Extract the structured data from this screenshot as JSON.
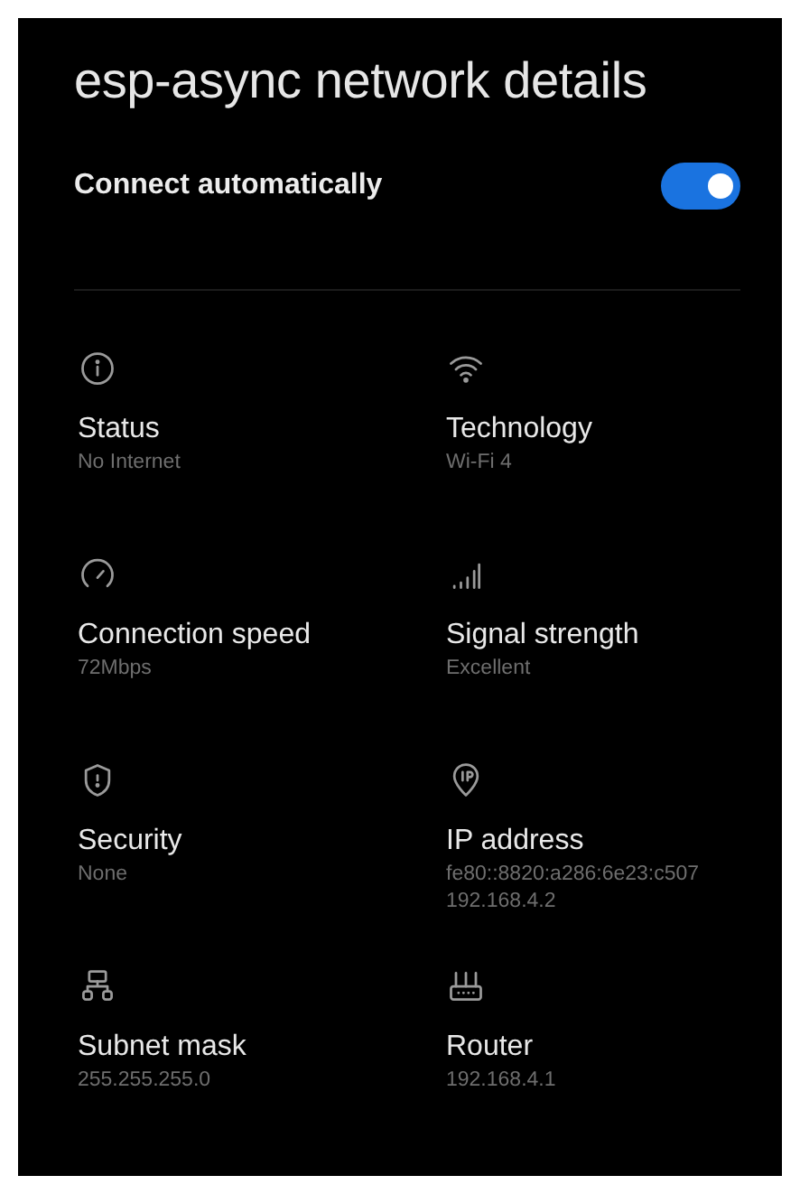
{
  "title": "esp-async network details",
  "auto_connect": {
    "label": "Connect automatically",
    "on": true
  },
  "details": [
    {
      "kind": "info",
      "label": "Status",
      "values": [
        "No Internet"
      ]
    },
    {
      "kind": "wifi",
      "label": "Technology",
      "values": [
        "Wi-Fi 4"
      ]
    },
    {
      "kind": "speed",
      "label": "Connection speed",
      "values": [
        "72Mbps"
      ]
    },
    {
      "kind": "signal",
      "label": "Signal strength",
      "values": [
        "Excellent"
      ]
    },
    {
      "kind": "shield",
      "label": "Security",
      "values": [
        "None"
      ]
    },
    {
      "kind": "pin",
      "label": "IP address",
      "values": [
        "fe80::8820:a286:6e23:c507",
        "192.168.4.2"
      ]
    },
    {
      "kind": "network",
      "label": "Subnet mask",
      "values": [
        "255.255.255.0"
      ]
    },
    {
      "kind": "router",
      "label": "Router",
      "values": [
        "192.168.4.1"
      ]
    }
  ]
}
